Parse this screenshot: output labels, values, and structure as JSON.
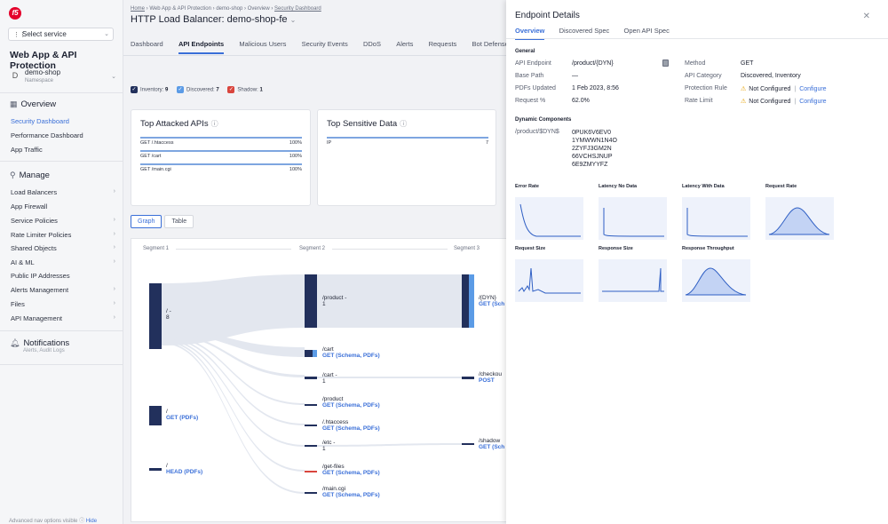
{
  "sidebar": {
    "select_service": "Select service",
    "app_title": "Web App & API Protection",
    "namespace": {
      "avatar": "D",
      "name": "demo-shop",
      "label": "Namespace"
    },
    "overview": {
      "title": "Overview",
      "items": [
        {
          "label": "Security Dashboard",
          "active": true
        },
        {
          "label": "Performance Dashboard"
        },
        {
          "label": "App Traffic"
        }
      ]
    },
    "manage": {
      "title": "Manage",
      "items": [
        {
          "label": "Load Balancers",
          "arrow": true
        },
        {
          "label": "App Firewall"
        },
        {
          "label": "Service Policies",
          "arrow": true
        },
        {
          "label": "Rate Limiter Policies",
          "arrow": true
        },
        {
          "label": "Shared Objects",
          "arrow": true
        },
        {
          "label": "AI & ML",
          "arrow": true
        },
        {
          "label": "Public IP Addresses"
        },
        {
          "label": "Alerts Management",
          "arrow": true
        },
        {
          "label": "Files",
          "arrow": true
        },
        {
          "label": "API Management",
          "arrow": true
        }
      ]
    },
    "notifications": {
      "title": "Notifications",
      "sub": "Alerts, Audit Logs"
    },
    "footer": {
      "text": "Advanced nav options visible",
      "hide": "Hide"
    }
  },
  "main": {
    "breadcrumb": [
      "Home",
      "Web App & API Protection",
      "demo-shop",
      "Overview",
      "Security Dashboard"
    ],
    "title": "HTTP Load Balancer: demo-shop-fe",
    "tabs": [
      "Dashboard",
      "API Endpoints",
      "Malicious Users",
      "Security Events",
      "DDoS",
      "Alerts",
      "Requests",
      "Bot Defense"
    ],
    "active_tab": "API Endpoints",
    "legend": [
      {
        "label": "Inventory:",
        "count": "9",
        "color": "#22305c"
      },
      {
        "label": "Discovered:",
        "count": "7",
        "color": "#5b9be6"
      },
      {
        "label": "Shadow:",
        "count": "1",
        "color": "#d9453d"
      }
    ],
    "top_attacked": {
      "title": "Top Attacked APIs",
      "rows": [
        {
          "api": "GET /.htaccess",
          "pct": "100%"
        },
        {
          "api": "GET /cart",
          "pct": "100%"
        },
        {
          "api": "GET /main.cgi",
          "pct": "100%"
        }
      ]
    },
    "top_sensitive": {
      "title": "Top Sensitive Data",
      "rows": [
        {
          "type": "IP",
          "count": "7"
        }
      ]
    },
    "view_toggle": [
      "Graph",
      "Table"
    ],
    "graph": {
      "segments": [
        "Segment 1",
        "Segment 2",
        "Segment 3"
      ],
      "nodes": {
        "root": {
          "name": "/ -",
          "count": "8"
        },
        "get_root": {
          "name": "/",
          "sub": "GET (PDFs)"
        },
        "head_root": {
          "name": "/",
          "sub": "HEAD (PDFs)"
        },
        "product_dash": {
          "name": "/product -",
          "count": "1"
        },
        "cart": {
          "name": "/cart",
          "sub": "GET (Schema, PDFs)"
        },
        "cart_dash": {
          "name": "/cart -",
          "count": "1"
        },
        "product": {
          "name": "/product",
          "sub": "GET (Schema, PDFs)"
        },
        "htaccess": {
          "name": "/.htaccess",
          "sub": "GET (Schema, PDFs)"
        },
        "etc_dash": {
          "name": "/etc -",
          "count": "1"
        },
        "get_files": {
          "name": "/get-files",
          "sub": "GET (Schema, PDFs)"
        },
        "main_cgi": {
          "name": "/main.cgi",
          "sub": "GET (Schema, PDFs)"
        },
        "dyn": {
          "name": "/{DYN}",
          "sub": "GET (Sch"
        },
        "checkout": {
          "name": "/checkou",
          "sub": "POST"
        },
        "shadow": {
          "name": "/shadow",
          "sub": "GET (Sch"
        }
      }
    }
  },
  "details": {
    "title": "Endpoint Details",
    "tabs": [
      "Overview",
      "Discovered Spec",
      "Open API Spec"
    ],
    "active_tab": "Overview",
    "general_title": "General",
    "left": [
      {
        "k": "API Endpoint",
        "v": "/product/{DYN}"
      },
      {
        "k": "Base Path",
        "v": "—"
      },
      {
        "k": "PDFs Updated",
        "v": "1 Feb 2023, 8:56"
      },
      {
        "k": "Request %",
        "v": "62.0%"
      }
    ],
    "right": [
      {
        "k": "Method",
        "v": "GET"
      },
      {
        "k": "API Category",
        "v": "Discovered, Inventory"
      },
      {
        "k": "Protection Rule",
        "v": "Not Configured",
        "link": "Configure"
      },
      {
        "k": "Rate Limit",
        "v": "Not Configured",
        "link": "Configure"
      }
    ],
    "dynamic_title": "Dynamic Components",
    "dynamic": {
      "key": "/product/$DYN$",
      "values": [
        "0PUK6V6EV0",
        "1YMWWN1N4O",
        "2ZYFJ3GM2N",
        "66VCHSJNUP",
        "6E9ZMYYFZ"
      ]
    },
    "charts": [
      "Error Rate",
      "Latency No Data",
      "Latency With Data",
      "Request Rate",
      "Request Size",
      "Response Size",
      "Response Throughput"
    ]
  },
  "colors": {
    "accent": "#3a6fd8",
    "node": "#22305c",
    "discovered": "#5b9be6",
    "shadow": "#d9453d",
    "warning": "#e6a000"
  }
}
